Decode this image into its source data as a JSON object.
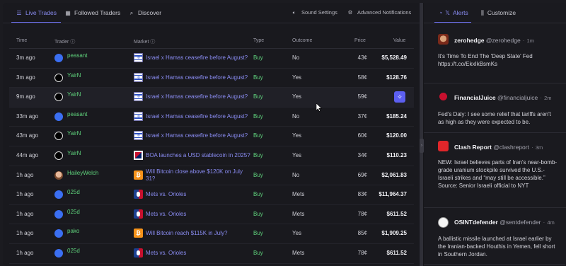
{
  "tabs": [
    {
      "label": "Live Trades",
      "icon": "list-icon"
    },
    {
      "label": "Followed Traders",
      "icon": "grid-icon"
    },
    {
      "label": "Discover",
      "icon": "search-icon"
    }
  ],
  "tools": [
    {
      "label": "Sound Settings",
      "icon": "speaker-icon"
    },
    {
      "label": "Advanced Notifications",
      "icon": "gear-icon"
    }
  ],
  "table": {
    "headers": {
      "time": "Time",
      "trader": "Trader",
      "market": "Market",
      "type": "Type",
      "outcome": "Outcome",
      "price": "Price",
      "value": "Value"
    },
    "rows": [
      {
        "time": "3m ago",
        "trader": "peasant",
        "market": "Israel x Hamas ceasefire before August?",
        "type": "Buy",
        "outcome": "No",
        "price": "43¢",
        "value": "$5,528.49"
      },
      {
        "time": "3m ago",
        "trader": "YairN",
        "market": "Israel x Hamas ceasefire before August?",
        "type": "Buy",
        "outcome": "Yes",
        "price": "58¢",
        "value": "$128.76"
      },
      {
        "time": "9m ago",
        "trader": "YairN",
        "market": "Israel x Hamas ceasefire before August?",
        "type": "Buy",
        "outcome": "Yes",
        "price": "59¢",
        "value": ""
      },
      {
        "time": "33m ago",
        "trader": "peasant",
        "market": "Israel x Hamas ceasefire before August?",
        "type": "Buy",
        "outcome": "No",
        "price": "37¢",
        "value": "$185.24"
      },
      {
        "time": "43m ago",
        "trader": "YairN",
        "market": "Israel x Hamas ceasefire before August?",
        "type": "Buy",
        "outcome": "Yes",
        "price": "60¢",
        "value": "$120.00"
      },
      {
        "time": "44m ago",
        "trader": "YairN",
        "market": "BOA launches a USD stablecoin in 2025?",
        "type": "Buy",
        "outcome": "Yes",
        "price": "34¢",
        "value": "$110.23"
      },
      {
        "time": "1h ago",
        "trader": "HaileyWelch",
        "market": "Will Bitcoin close above $120K on July 31?",
        "type": "Buy",
        "outcome": "No",
        "price": "69¢",
        "value": "$2,061.83"
      },
      {
        "time": "1h ago",
        "trader": "025d",
        "market": "Mets vs. Orioles",
        "type": "Buy",
        "outcome": "Mets",
        "price": "83¢",
        "value": "$11,964.37"
      },
      {
        "time": "1h ago",
        "trader": "025d",
        "market": "Mets vs. Orioles",
        "type": "Buy",
        "outcome": "Mets",
        "price": "78¢",
        "value": "$611.52"
      },
      {
        "time": "1h ago",
        "trader": "pako",
        "market": "Will Bitcoin reach $115K in July?",
        "type": "Buy",
        "outcome": "Yes",
        "price": "85¢",
        "value": "$1,909.25"
      },
      {
        "time": "1h ago",
        "trader": "025d",
        "market": "Mets vs. Orioles",
        "type": "Buy",
        "outcome": "Mets",
        "price": "78¢",
        "value": "$611.52"
      }
    ]
  },
  "right_tabs": [
    {
      "label": "Alerts",
      "icon": "rss-x-icon"
    },
    {
      "label": "Customize",
      "icon": "sliders-icon"
    }
  ],
  "feed": [
    {
      "name": "zerohedge",
      "handle": "@zerohedge",
      "time": "1m",
      "text": "It's Time To End The 'Deep State' Fed https://t.co/EkxIkBsmKs"
    },
    {
      "name": "FinancialJuice",
      "handle": "@financialjuice",
      "time": "2m",
      "text": "Fed's Daly: I see some relief that tariffs aren't as high as they were expected to be."
    },
    {
      "name": "Clash Report",
      "handle": "@clashreport",
      "time": "3m",
      "text": "NEW: Israel believes parts of Iran's near-bomb-grade uranium stockpile survived the U.S.-Israeli strikes and “may still be accessible.” Source: Senior Israeli official to NYT"
    },
    {
      "name": "OSINTdefender",
      "handle": "@sentdefender",
      "time": "4m",
      "text": "A ballistic missile launched at Israel earlier by the Iranian-backed Houthis in Yemen, fell short in Southern Jordan."
    }
  ],
  "colors": {
    "accent": "#6d6ff0",
    "buy": "#5fd27c",
    "link": "#8a8cf2"
  }
}
